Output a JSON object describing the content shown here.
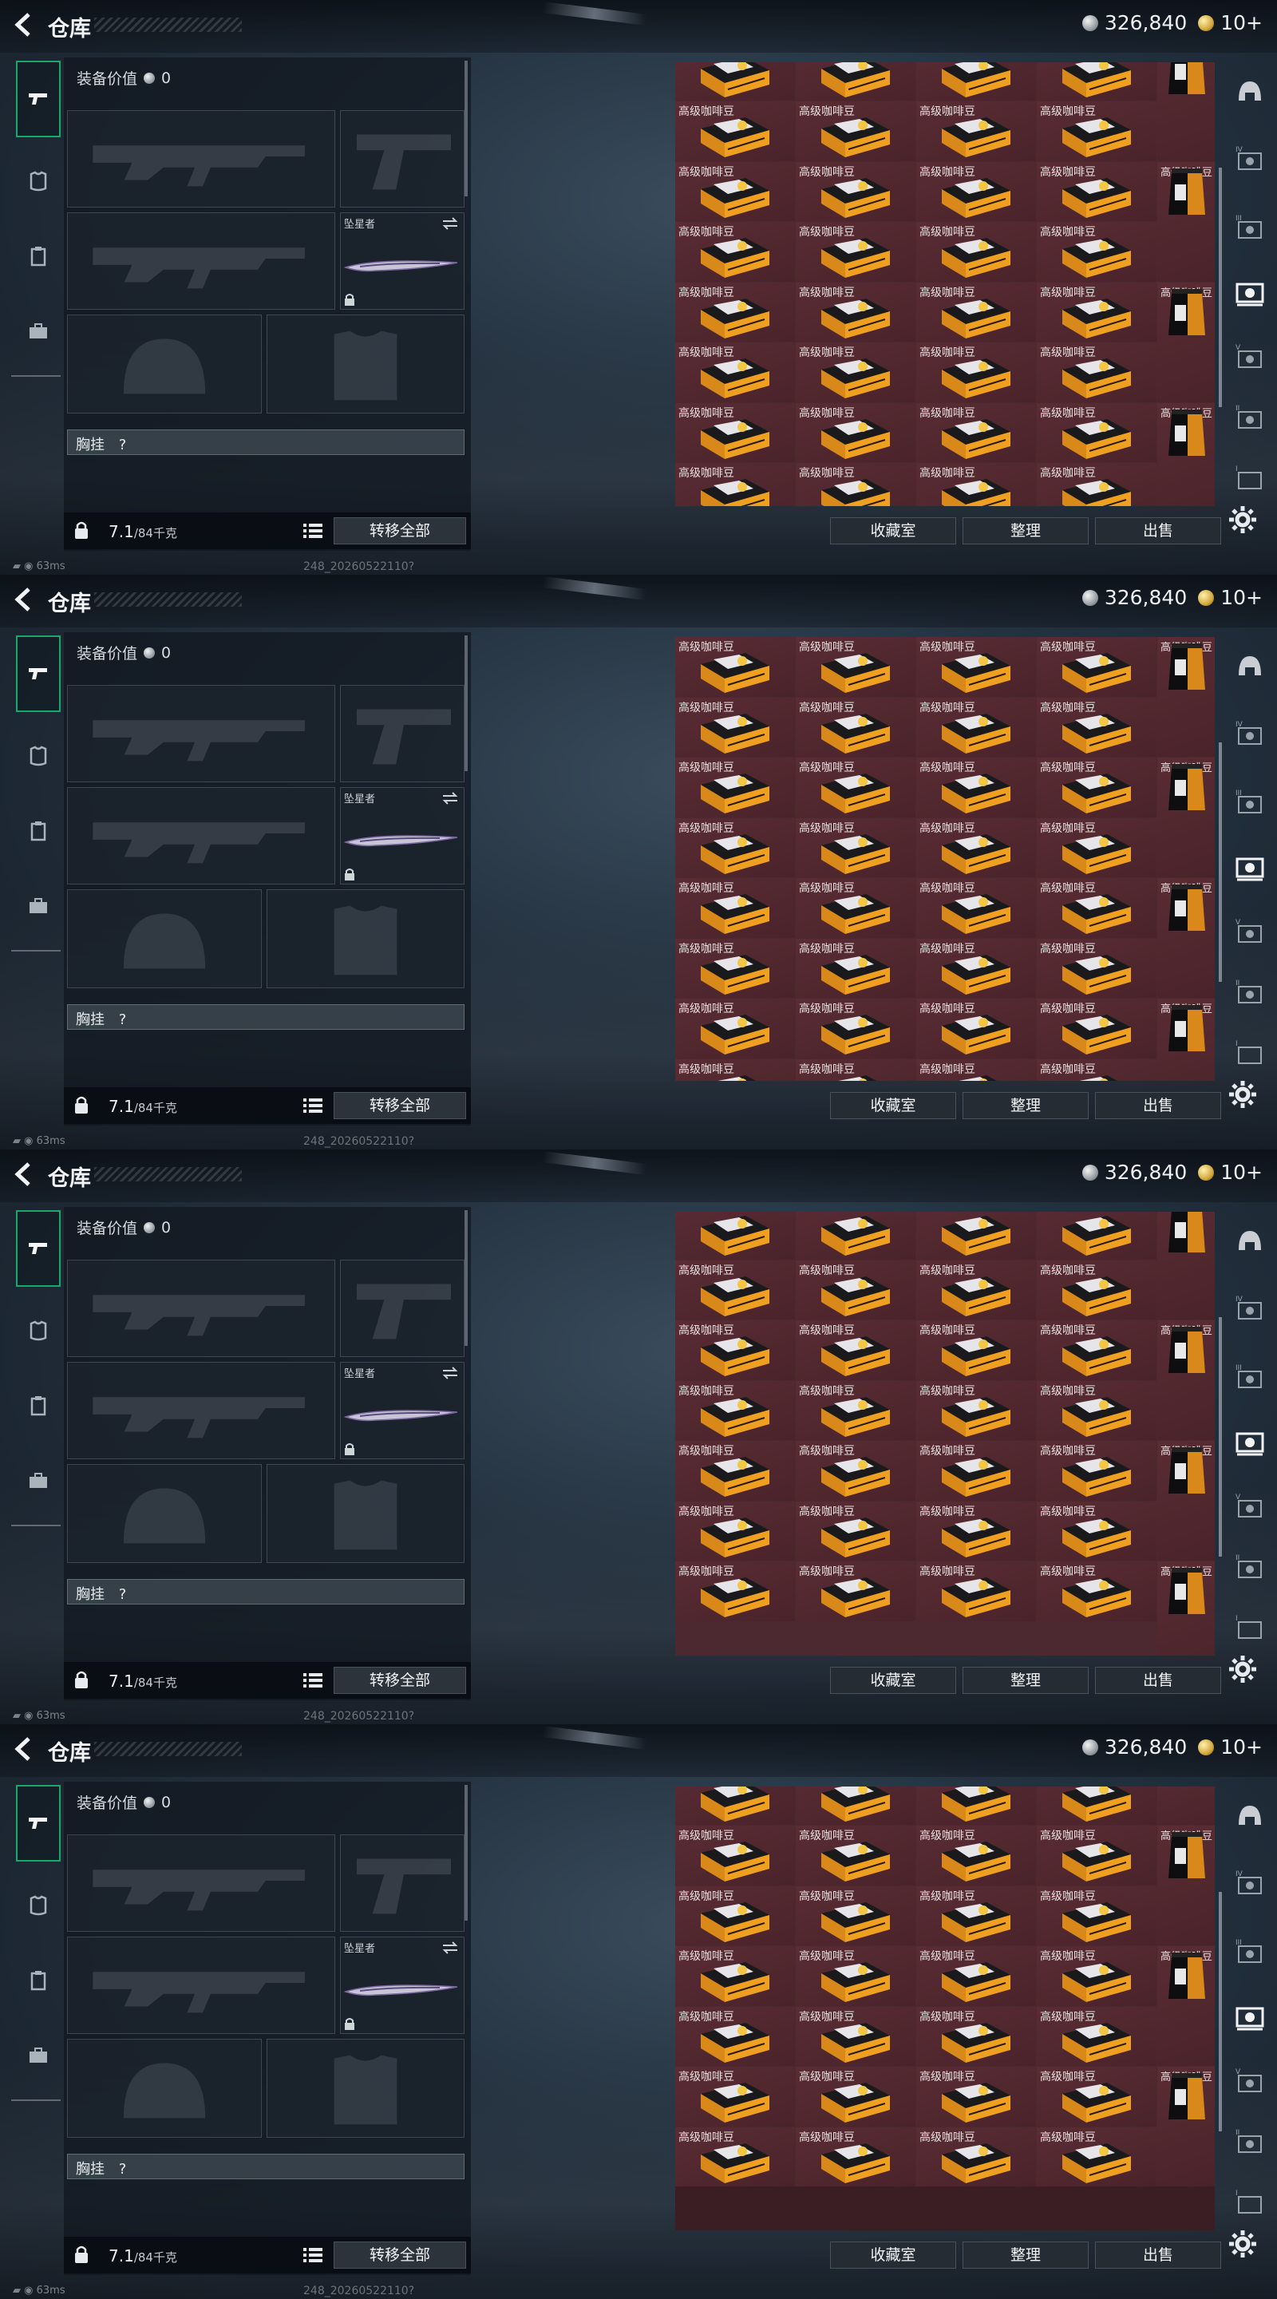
{
  "header": {
    "title": "仓库",
    "silver_amount": "326,840",
    "gold_amount": "10+"
  },
  "sidebar": {
    "items": [
      {
        "name": "weapons",
        "icon": "pistol-icon",
        "active": true
      },
      {
        "name": "equipment",
        "icon": "armor-icon",
        "active": false
      },
      {
        "name": "tasks",
        "icon": "clipboard-icon",
        "active": false
      },
      {
        "name": "backpack",
        "icon": "briefcase-icon",
        "active": false
      }
    ]
  },
  "equipment": {
    "value_label": "装备价值",
    "value": "0",
    "melee_name": "坠星者",
    "chest_rig_label": "胸挂",
    "chest_rig_help": "?",
    "weight_current": "7.1",
    "weight_max": "/84千克",
    "transfer_all": "转移全部"
  },
  "storage": {
    "item_name": "高级咖啡豆",
    "frames": [
      {
        "offset_rows": 0.35,
        "label_rows": [
          1,
          2,
          3,
          4,
          5,
          6,
          7
        ],
        "bags": [
          0,
          2,
          4,
          6
        ],
        "rows": 8
      },
      {
        "offset_rows": 0,
        "label_rows": [
          0,
          1,
          2,
          3,
          4,
          5,
          6,
          7
        ],
        "bags": [
          0,
          2,
          4,
          6
        ],
        "rows": 8
      },
      {
        "offset_rows": 0.2,
        "label_rows": [
          1,
          2,
          3,
          4,
          5,
          6
        ],
        "bags": [
          0,
          2,
          4,
          6
        ],
        "rows": 7
      },
      {
        "offset_rows": 0.35,
        "label_rows": [
          1,
          2,
          3,
          4,
          5,
          6
        ],
        "bags": [
          1,
          3,
          5
        ],
        "rows": 7
      }
    ]
  },
  "actions": {
    "collection": "收藏室",
    "organize": "整理",
    "sell": "出售"
  },
  "right_sidebar": {
    "items": [
      "helmet-icon",
      "level-iv-icon",
      "level-iii-icon",
      "camera-icon",
      "level-v-icon",
      "level-ii-icon",
      "level-i-icon"
    ]
  },
  "status": {
    "ping": "63ms",
    "build": "248_20260522110?"
  },
  "colors": {
    "accent_green": "#17a86a",
    "cell_bg": "#4a232a",
    "coin_gold": "#d4a83c"
  }
}
